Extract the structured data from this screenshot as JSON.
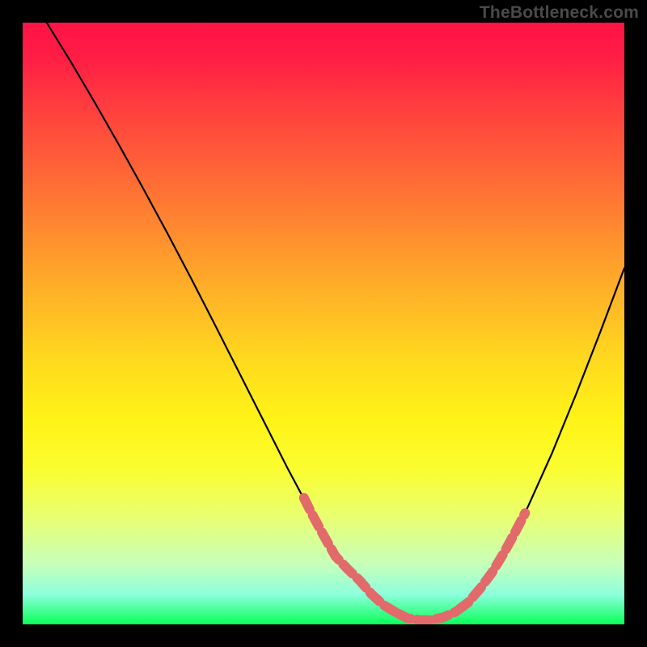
{
  "watermark": "TheBottleneck.com",
  "chart_data": {
    "type": "line",
    "title": "",
    "xlabel": "",
    "ylabel": "",
    "xlim": [
      0,
      100
    ],
    "ylim": [
      0,
      100
    ],
    "grid": false,
    "series": [
      {
        "name": "curve",
        "x": [
          4,
          8,
          12,
          16,
          20,
          24,
          28,
          32,
          36,
          40,
          44,
          48,
          51,
          54,
          57,
          60,
          63,
          66,
          69,
          72,
          76,
          80,
          84,
          88,
          92,
          96,
          100
        ],
        "y": [
          100,
          93.5,
          86.7,
          79.7,
          72.5,
          65.1,
          57.5,
          49.7,
          41.8,
          33.9,
          26.0,
          18.5,
          13.5,
          9.2,
          5.7,
          3.2,
          1.6,
          0.7,
          0.8,
          2.1,
          5.9,
          11.9,
          19.6,
          28.5,
          38.3,
          48.6,
          59.2
        ],
        "color": "#000000",
        "strokeWidth": 2.2
      }
    ],
    "accent_segments": [
      {
        "name": "accent-left",
        "x": [
          46.5,
          48,
          50,
          52,
          54,
          56,
          58,
          60,
          62
        ],
        "y": [
          21.5,
          18.5,
          14.8,
          11.3,
          9.2,
          7.3,
          5.0,
          3.2,
          2.0
        ],
        "color": "#e26a6a",
        "strokeWidth": 12,
        "dash": [
          16,
          8
        ]
      },
      {
        "name": "accent-bottom",
        "x": [
          62,
          64,
          66,
          68,
          70,
          72
        ],
        "y": [
          2.0,
          1.0,
          0.7,
          0.7,
          1.2,
          2.1
        ],
        "color": "#e26a6a",
        "strokeWidth": 12,
        "dash": [
          16,
          8
        ]
      },
      {
        "name": "accent-right",
        "x": [
          72,
          74,
          76,
          78,
          80,
          82,
          83.5
        ],
        "y": [
          2.1,
          3.6,
          5.9,
          8.6,
          11.9,
          15.6,
          18.5
        ],
        "color": "#e26a6a",
        "strokeWidth": 12,
        "dash": [
          16,
          8
        ]
      }
    ],
    "gradient_stops": [
      {
        "offset": 0,
        "color": "#ff1347"
      },
      {
        "offset": 6,
        "color": "#ff1e44"
      },
      {
        "offset": 14,
        "color": "#ff3e3f"
      },
      {
        "offset": 26,
        "color": "#ff6a36"
      },
      {
        "offset": 42,
        "color": "#ffa72a"
      },
      {
        "offset": 56,
        "color": "#ffd91e"
      },
      {
        "offset": 66,
        "color": "#fff317"
      },
      {
        "offset": 74,
        "color": "#fbfd2f"
      },
      {
        "offset": 82,
        "color": "#e9ff70"
      },
      {
        "offset": 90,
        "color": "#c7ffba"
      },
      {
        "offset": 95,
        "color": "#8dffdc"
      },
      {
        "offset": 100,
        "color": "#0aff5a"
      }
    ]
  }
}
